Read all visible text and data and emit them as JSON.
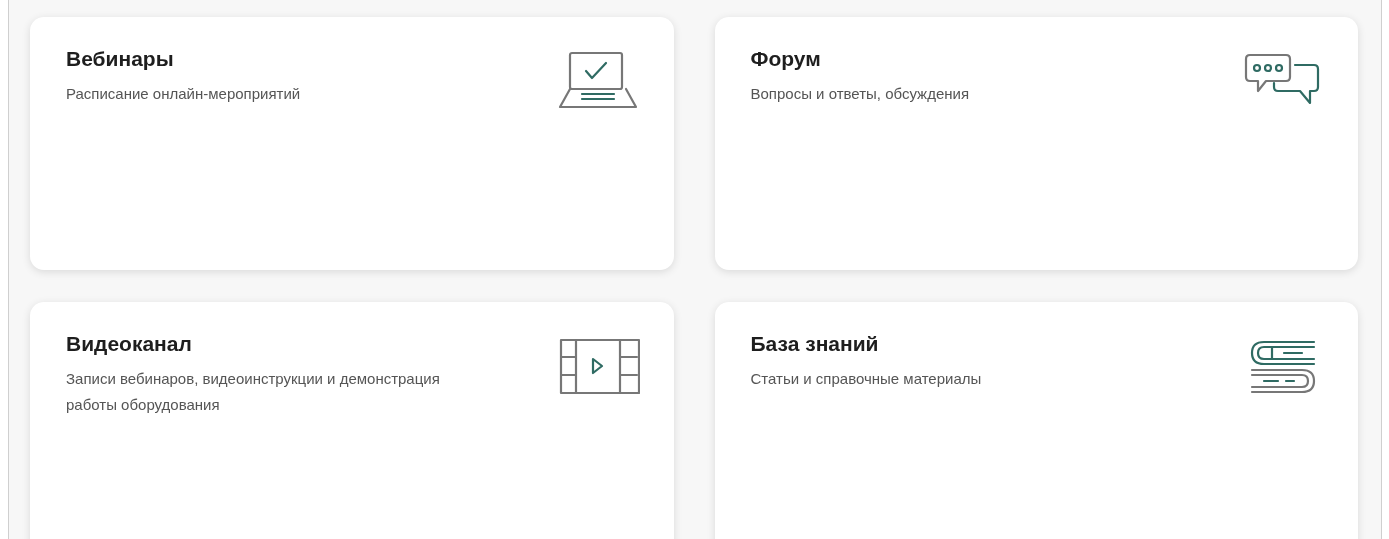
{
  "cards": [
    {
      "title": "Вебинары",
      "description": "Расписание онлайн-мероприятий",
      "kind": "laptop"
    },
    {
      "title": "Форум",
      "description": "Вопросы и ответы, обсуждения",
      "kind": "chat"
    },
    {
      "title": "Видеоканал",
      "description": "Записи вебинаров, видеоинструкции и демонстрация работы оборудования",
      "kind": "film"
    },
    {
      "title": "База знаний",
      "description": "Статьи и справочные материалы",
      "kind": "books"
    }
  ]
}
